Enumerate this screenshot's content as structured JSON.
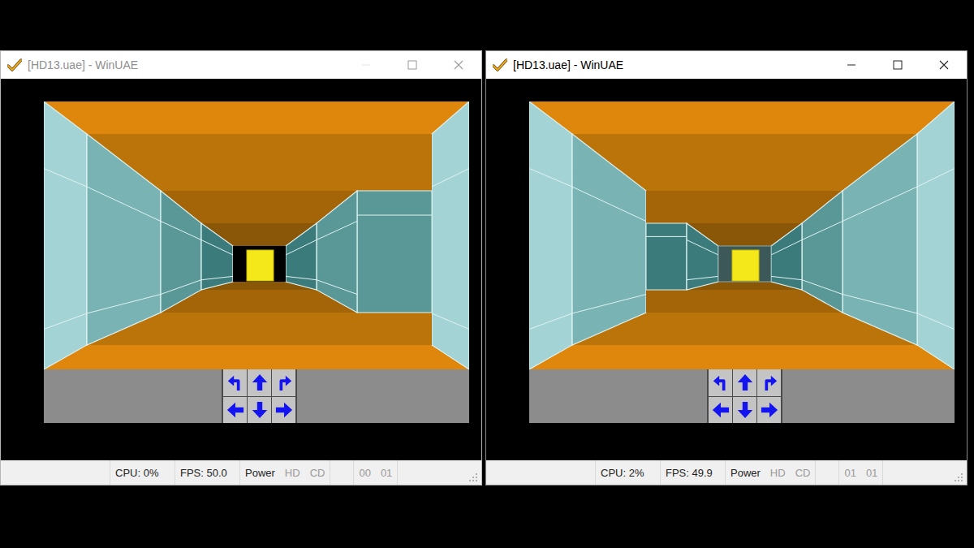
{
  "windows": [
    {
      "title": "[HD13.uae] - WinUAE",
      "active": false,
      "scene": {
        "left_walls": [
          true,
          true,
          true,
          true
        ],
        "right_walls": [
          true,
          false,
          true,
          true
        ],
        "end_open": true
      },
      "status_bar": {
        "readings": [
          "CPU: 0%",
          "FPS: 50.0"
        ],
        "leds": [
          {
            "label": "Power",
            "on": true
          },
          {
            "label": "HD",
            "on": false
          },
          {
            "label": "CD",
            "on": false
          }
        ],
        "drives": [
          {
            "label": "00",
            "on": false
          },
          {
            "label": "01",
            "on": false
          }
        ]
      }
    },
    {
      "title": "[HD13.uae] - WinUAE",
      "active": true,
      "scene": {
        "left_walls": [
          true,
          true,
          false,
          true
        ],
        "right_walls": [
          true,
          true,
          true,
          true
        ],
        "end_open": false
      },
      "status_bar": {
        "readings": [
          "CPU: 2%",
          "FPS: 49.9"
        ],
        "leds": [
          {
            "label": "Power",
            "on": true
          },
          {
            "label": "HD",
            "on": false
          },
          {
            "label": "CD",
            "on": false
          }
        ],
        "drives": [
          {
            "label": "01",
            "on": false
          },
          {
            "label": "01",
            "on": false
          }
        ]
      }
    }
  ]
}
